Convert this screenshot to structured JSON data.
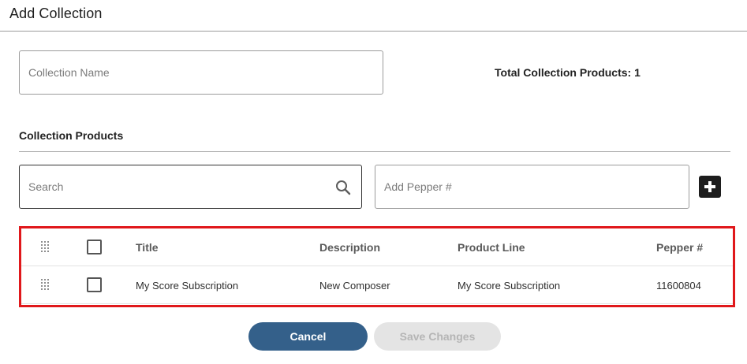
{
  "dialog": {
    "title": "Add Collection"
  },
  "form": {
    "collection_name": {
      "placeholder": "Collection Name",
      "value": ""
    },
    "total_label": "Total Collection Products: 1"
  },
  "products_section": {
    "title": "Collection Products",
    "search": {
      "placeholder": "Search",
      "icon": "search-icon"
    },
    "add_pepper": {
      "placeholder": "Add Pepper #",
      "button_icon": "plus-icon"
    }
  },
  "table": {
    "columns": [
      "Title",
      "Description",
      "Product Line",
      "Pepper #"
    ],
    "rows": [
      {
        "title": "My Score Subscription",
        "description": "New Composer",
        "product_line": "My Score Subscription",
        "pepper": "11600804",
        "checked": false
      }
    ],
    "highlight_color": "#e0181b"
  },
  "actions": {
    "cancel_label": "Cancel",
    "save_label": "Save Changes",
    "primary_color": "#34608a",
    "disabled_color": "#e4e4e4"
  }
}
